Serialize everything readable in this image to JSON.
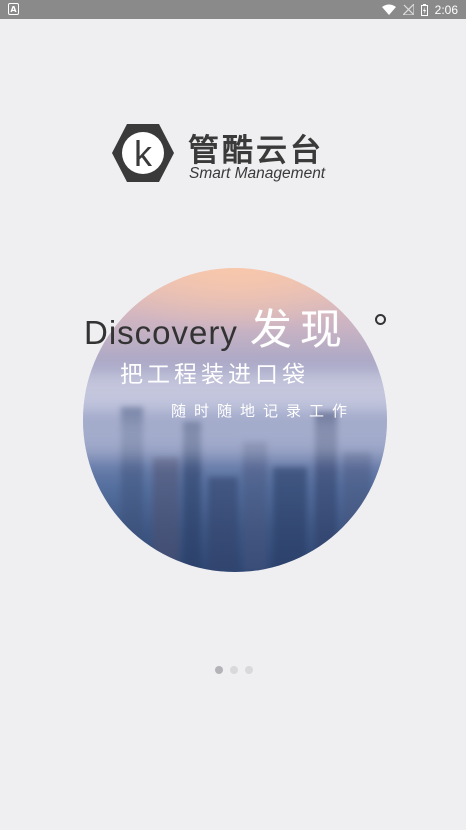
{
  "status_bar": {
    "time": "2:06",
    "notification_icon": "app-notification-icon",
    "icons": [
      "wifi-icon",
      "signal-off-icon",
      "battery-charging-icon"
    ]
  },
  "logo": {
    "title": "管酷云台",
    "subtitle": "Smart Management",
    "mark_letter": "k"
  },
  "slide": {
    "headline_en": "Discovery",
    "headline_cn": "发现",
    "tagline_primary": "把工程装进口袋",
    "tagline_secondary": "随时随地记录工作"
  },
  "pager": {
    "count": 3,
    "active_index": 0
  },
  "colors": {
    "background": "#efeff2",
    "status_bar": "#8a8a8a",
    "text_dark": "#333333"
  }
}
